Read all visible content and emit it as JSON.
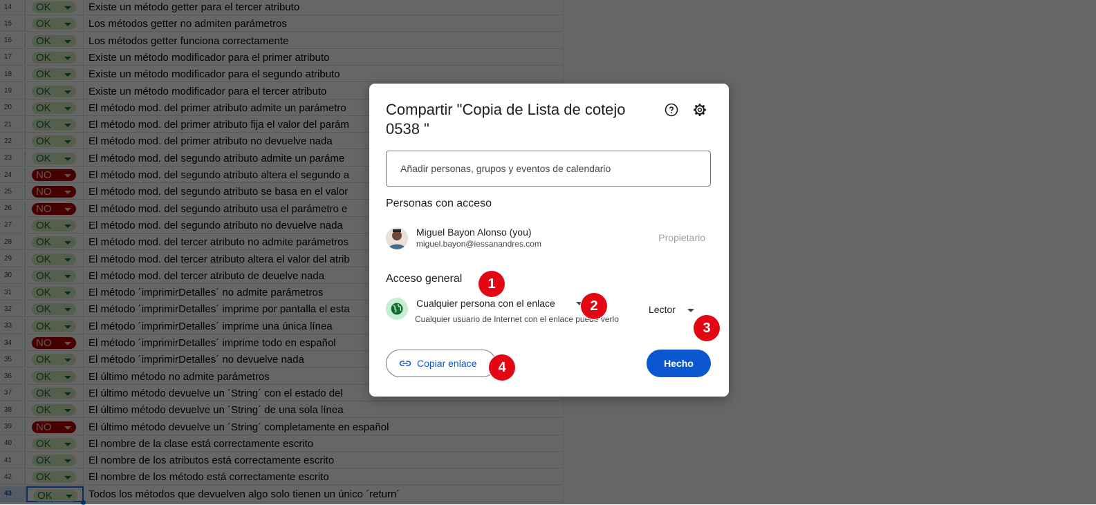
{
  "sheet": {
    "rows": [
      {
        "num": "14",
        "status": "OK",
        "text": "Existe un método getter para el tercer atributo"
      },
      {
        "num": "15",
        "status": "OK",
        "text": "Los métodos getter no admiten parámetros"
      },
      {
        "num": "16",
        "status": "OK",
        "text": "Los métodos getter funciona correctamente"
      },
      {
        "num": "17",
        "status": "OK",
        "text": "Existe un método modificador para el primer atributo"
      },
      {
        "num": "18",
        "status": "OK",
        "text": "Existe un método modificador para el segundo atributo"
      },
      {
        "num": "19",
        "status": "OK",
        "text": "Existe un método modificador para el tercer atributo"
      },
      {
        "num": "20",
        "status": "OK",
        "text": "El método mod. del primer atributo admite un parámetro"
      },
      {
        "num": "21",
        "status": "OK",
        "text": "El método mod. del primer atributo fija el valor del parám"
      },
      {
        "num": "22",
        "status": "OK",
        "text": "El método mod. del primer atributo no devuelve nada"
      },
      {
        "num": "23",
        "status": "OK",
        "text": "El método mod. del segundo atributo admite un paráme"
      },
      {
        "num": "24",
        "status": "NO",
        "text": "El método mod. del segundo atributo altera el segundo a"
      },
      {
        "num": "25",
        "status": "NO",
        "text": "El método mod. del segundo atributo se basa en el valor"
      },
      {
        "num": "26",
        "status": "NO",
        "text": "El método mod. del segundo atributo usa el parámetro e"
      },
      {
        "num": "27",
        "status": "OK",
        "text": "El método mod. del segundo atributo no devuelve nada"
      },
      {
        "num": "28",
        "status": "OK",
        "text": "El método mod. del tercer atributo no admite parámetros"
      },
      {
        "num": "29",
        "status": "OK",
        "text": "El método mod. del tercer atributo altera el valor del atrib"
      },
      {
        "num": "30",
        "status": "OK",
        "text": "El método mod. del tercer atributo de deuelve nada"
      },
      {
        "num": "31",
        "status": "OK",
        "text": "El método ´imprimirDetalles´ no admite parámetros"
      },
      {
        "num": "32",
        "status": "OK",
        "text": "El método ´imprimirDetalles´ imprime por pantalla el esta"
      },
      {
        "num": "33",
        "status": "OK",
        "text": "El método ´imprimirDetalles´ imprime una única línea"
      },
      {
        "num": "34",
        "status": "NO",
        "text": "El método ´imprimirDetalles´ imprime todo en español"
      },
      {
        "num": "35",
        "status": "OK",
        "text": "El método ´imprimirDetalles´ no devuelve nada"
      },
      {
        "num": "36",
        "status": "OK",
        "text": "El último método no admite parámetros"
      },
      {
        "num": "37",
        "status": "OK",
        "text": "El último método devuelve un ´String´ con el estado del"
      },
      {
        "num": "38",
        "status": "OK",
        "text": "El último método devuelve un ´String´ de una sola línea"
      },
      {
        "num": "39",
        "status": "NO",
        "text": "El último método devuelve un ´String´ completamente en español"
      },
      {
        "num": "40",
        "status": "OK",
        "text": "El nombre de la clase está correctamente escrito"
      },
      {
        "num": "41",
        "status": "OK",
        "text": "El nombre de los atributos está correctamente escrito"
      },
      {
        "num": "42",
        "status": "OK",
        "text": "El nombre de los método está correctamente escrito"
      },
      {
        "num": "43",
        "status": "OK",
        "text": "Todos los métodos que devuelven algo solo tienen un único ´return´",
        "selected": true
      }
    ]
  },
  "dialog": {
    "title": "Compartir \"Copia de Lista de cotejo 0538 \"",
    "help_icon": "help-icon",
    "settings_icon": "gear-icon",
    "add_placeholder": "Añadir personas, grupos y eventos de calendario",
    "people_heading": "Personas con acceso",
    "person": {
      "name": "Miguel Bayon Alonso (you)",
      "email": "miguel.bayon@iessanandres.com",
      "role": "Propietario"
    },
    "general_heading": "Acceso general",
    "access_option": "Cualquier persona con el enlace",
    "access_desc": "Cualquier usuario de Internet con el enlace puede verlo",
    "role_option": "Lector",
    "copy_link": "Copiar enlace",
    "done": "Hecho"
  },
  "badges": [
    "1",
    "2",
    "3",
    "4"
  ],
  "colors": {
    "ok_bg": "#d4edbc",
    "ok_text": "#11734b",
    "no_bg": "#b10202",
    "no_text": "#ffcfc9",
    "primary": "#0b57d0",
    "badge": "#e30613"
  }
}
